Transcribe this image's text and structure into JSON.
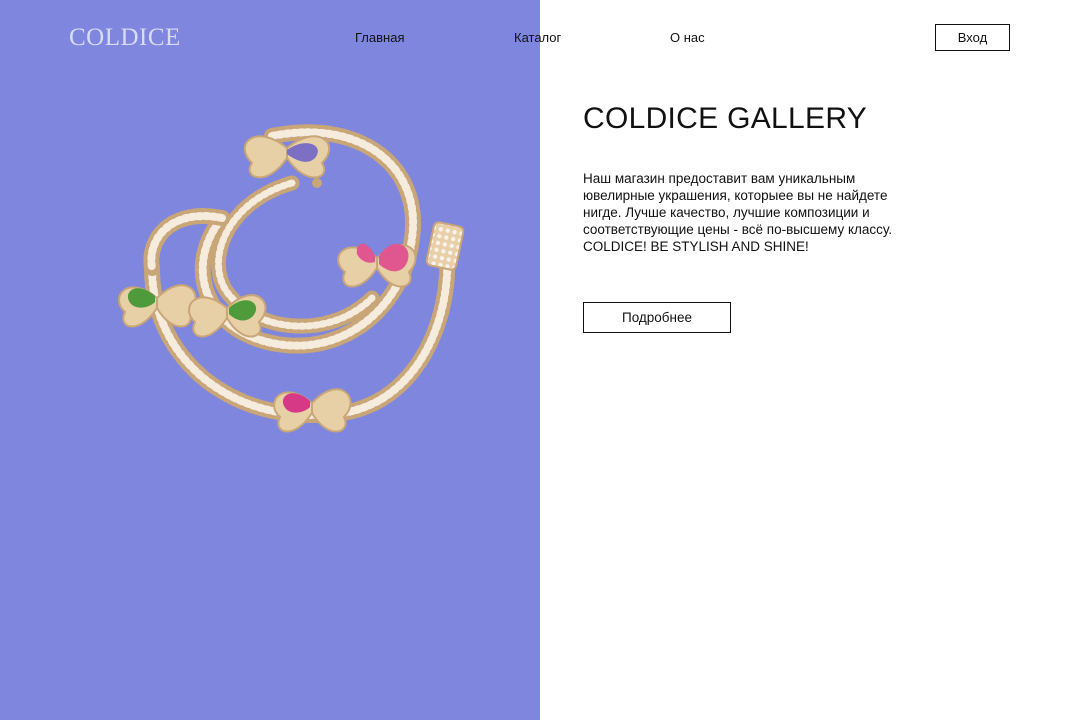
{
  "brand": {
    "logo_text": "COLDICE"
  },
  "nav": {
    "items": [
      {
        "label": "Главная"
      },
      {
        "label": "Каталог"
      },
      {
        "label": "О нас"
      }
    ],
    "login_label": "Вход"
  },
  "hero": {
    "title": "COLDICE GALLERY",
    "description": "Наш магазин предоставит вам уникальным ювелирные украшения, которыее вы не найдете нигде. Лучше качество, лучшие композиции и соответствующие цены - всё по-высшему классу. COLDICE! BE STYLISH AND SHINE!",
    "button_label": "Подробнее"
  },
  "colors": {
    "left_panel": "#7e86de",
    "background": "#ffffff",
    "text": "#111111",
    "gold": "#e2c39a",
    "butterfly_purple": "#7d6fc4",
    "butterfly_pink": "#e0568f",
    "butterfly_green": "#4f9a3a",
    "butterfly_magenta": "#d63a86"
  },
  "image": {
    "icon": "butterfly-chain-necklace"
  }
}
